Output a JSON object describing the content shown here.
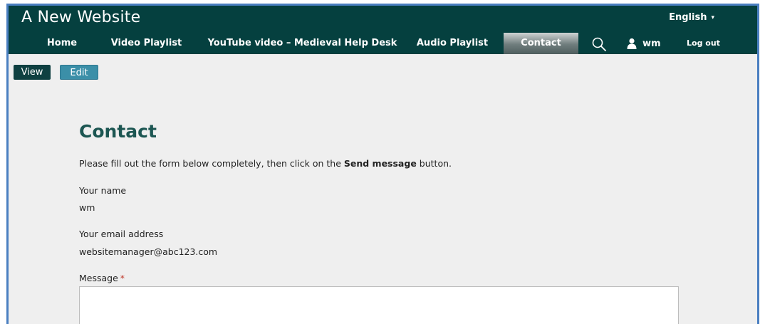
{
  "site": {
    "title": "A New Website"
  },
  "language": {
    "label": "English",
    "caret": "▾"
  },
  "nav": {
    "items": [
      {
        "label": "Home"
      },
      {
        "label": "Video Playlist"
      },
      {
        "label": "YouTube video – Medieval Help Desk"
      },
      {
        "label": "Audio Playlist"
      },
      {
        "label": "Contact"
      }
    ],
    "user": "wm",
    "logout": "Log out"
  },
  "tabs": {
    "view": "View",
    "edit": "Edit"
  },
  "page": {
    "title": "Contact",
    "intro_before": "Please fill out the form below completely, then click on the ",
    "intro_bold": "Send message",
    "intro_after": " button."
  },
  "form": {
    "name_label": "Your name",
    "name_value": "wm",
    "email_label": "Your email address",
    "email_value": "websitemanager@abc123.com",
    "message_label": "Message",
    "required_marker": "*",
    "message_value": ""
  },
  "colors": {
    "header_bg": "#05403f",
    "title_color": "#1c5652",
    "edit_tab": "#3b8fa8",
    "view_tab": "#0f4041"
  }
}
